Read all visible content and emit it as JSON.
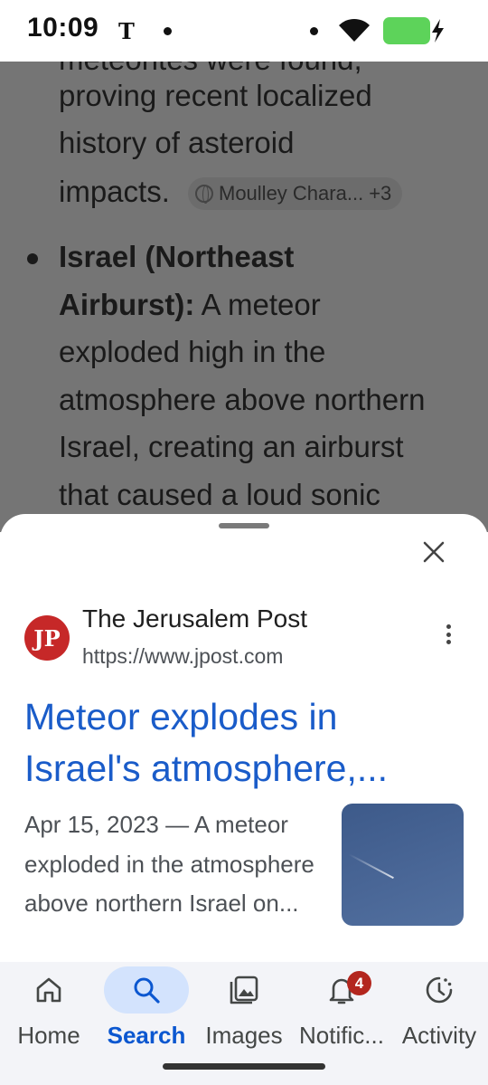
{
  "status_bar": {
    "time": "10:09",
    "carrier_glyph": "T"
  },
  "article": {
    "lines": [
      "meteorites were found,",
      "proving recent localized",
      "history of asteroid",
      "impacts."
    ],
    "source_chip": {
      "label": "Moulley Chara...",
      "more": "+3",
      "icon": "globe-icon"
    },
    "bullet_heading_1": "Israel (Northeast",
    "bullet_heading_2": "Airburst):",
    "bullet_text_2": " A meteor",
    "bullet_lines": [
      "exploded high in the",
      "atmosphere above northern",
      "Israel, creating an airburst",
      "that caused a loud sonic"
    ]
  },
  "sheet": {
    "site_logo_text": "JP",
    "site_name": "The Jerusalem Post",
    "site_url": "https://www.jpost.com",
    "title": "Meteor explodes in Israel's atmosphere,...",
    "snippet": "Apr 15, 2023 — A meteor exploded in the atmosphere above northern Israel on..."
  },
  "bottom_nav": {
    "items": [
      {
        "label": "Home",
        "icon": "home-icon",
        "active": false
      },
      {
        "label": "Search",
        "icon": "search-icon",
        "active": true
      },
      {
        "label": "Images",
        "icon": "images-icon",
        "active": false
      },
      {
        "label": "Notific...",
        "icon": "bell-icon",
        "active": false,
        "badge": "4"
      },
      {
        "label": "Activity",
        "icon": "activity-icon",
        "active": false
      }
    ]
  },
  "colors": {
    "link_blue": "#1a5cc9",
    "active_tab": "#0b57d0",
    "active_pill": "#d3e3fd",
    "badge_red": "#b3261e",
    "scrim_gray": "#757575"
  }
}
